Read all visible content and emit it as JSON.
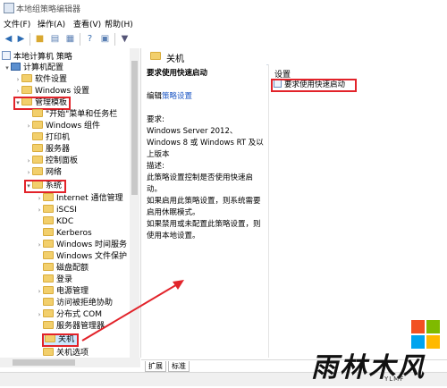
{
  "window": {
    "title": "本地组策略编辑器"
  },
  "menu": [
    "文件(F)",
    "操作(A)",
    "查看(V)",
    "帮助(H)"
  ],
  "toolbar_icons": [
    "back-arrow-icon",
    "forward-arrow-icon",
    "up-folder-icon",
    "show-hide-tree-icon",
    "export-list-icon",
    "help-icon",
    "properties-icon",
    "filter-icon"
  ],
  "tree": {
    "root": "本地计算机 策略",
    "computer_config": "计算机配置",
    "software_settings": "软件设置",
    "windows_settings": "Windows 设置",
    "admin_templates": "管理模板",
    "start_menu": "\"开始\"菜单和任务栏",
    "windows_components": "Windows 组件",
    "printers": "打印机",
    "servers": "服务器",
    "control_panel": "控制面板",
    "network": "网络",
    "system": "系统",
    "system_children": [
      "Internet 通信管理",
      "iSCSI",
      "KDC",
      "Kerberos",
      "Windows 时间服务",
      "Windows 文件保护",
      "磁盘配额",
      "登录",
      "电源管理",
      "访问被拒绝协助",
      "分布式 COM",
      "服务器管理器",
      "关机",
      "关机选项"
    ]
  },
  "header": {
    "title": "关机"
  },
  "description": {
    "policy_title": "要求使用快速启动",
    "edit_prefix": "编辑",
    "edit_link": "策略设置",
    "requirements_label": "要求:",
    "requirements_text": "Windows Server 2012、Windows 8 或 Windows RT 及以上版本",
    "desc_label": "描述:",
    "desc_text": "此策略设置控制是否使用快速启动。",
    "enabled_text": "如果启用此策略设置，则系统需要启用休眠模式。",
    "disabled_text": "如果禁用或未配置此策略设置，则使用本地设置。"
  },
  "list": {
    "column": "设置",
    "item": "要求使用快速启动"
  },
  "tabs": [
    "扩展",
    "标准"
  ],
  "watermark": {
    "text": "雨林木风",
    "sub": "YLMF"
  },
  "colors": {
    "highlight": "#e2232a",
    "selection": "#cde8ff",
    "link": "#1a55c4"
  }
}
